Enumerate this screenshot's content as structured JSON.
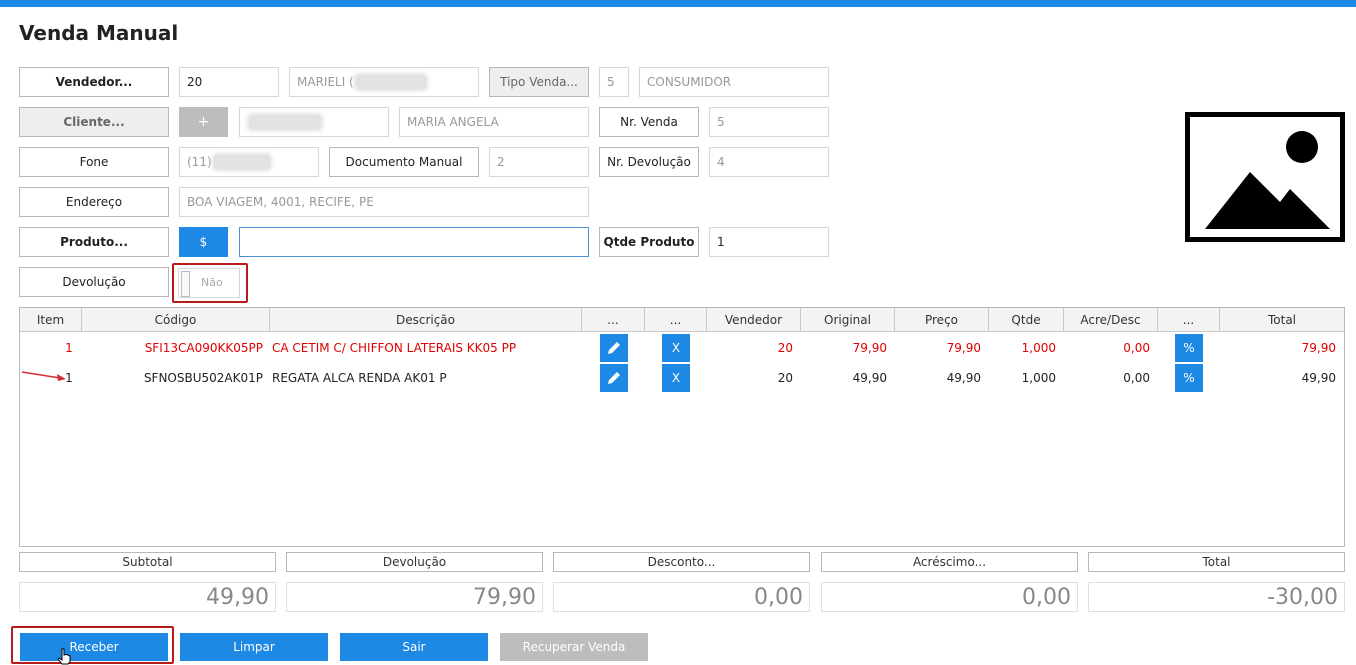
{
  "title": "Venda Manual",
  "form": {
    "vendedor_label": "Vendedor...",
    "vendedor_code": "20",
    "vendedor_name": "MARIELI (",
    "tipo_venda_label": "Tipo Venda...",
    "tipo_venda_code": "5",
    "tipo_venda_name": "CONSUMIDOR",
    "cliente_label": "Cliente...",
    "add_client_label": "+",
    "cliente_name": "MARIA ANGELA",
    "nr_venda_label": "Nr. Venda",
    "nr_venda_value": "5",
    "fone_label": "Fone",
    "fone_value": "(11)",
    "documento_label": "Documento Manual",
    "documento_value": "2",
    "nr_devolucao_label": "Nr. Devolução",
    "nr_devolucao_value": "4",
    "endereco_label": "Endereço",
    "endereco_value": "BOA VIAGEM, 4001, RECIFE, PE",
    "produto_label": "Produto...",
    "price_button_label": "$",
    "produto_value": "",
    "qtde_label": "Qtde Produto",
    "qtde_value": "1",
    "devolucao_label": "Devolução",
    "devolucao_toggle_text": "Não"
  },
  "grid": {
    "headers": [
      "Item",
      "Código",
      "Descrição",
      "...",
      "...",
      "Vendedor",
      "Original",
      "Preço",
      "Qtde",
      "Acre/Desc",
      "...",
      "Total"
    ],
    "rows": [
      {
        "item": "1",
        "codigo": "SFI13CA090KK05PP",
        "descricao": "CA CETIM C/ CHIFFON LATERAIS KK05 PP",
        "delete": "X",
        "vendedor": "20",
        "original": "79,90",
        "preco": "79,90",
        "qtde": "1,000",
        "acre_desc": "0,00",
        "percent": "%",
        "total": "79,90",
        "color": "#e00000"
      },
      {
        "item": "1",
        "codigo": "SFNOSBU502AK01P",
        "descricao": "REGATA ALCA RENDA AK01 P",
        "delete": "X",
        "vendedor": "20",
        "original": "49,90",
        "preco": "49,90",
        "qtde": "1,000",
        "acre_desc": "0,00",
        "percent": "%",
        "total": "49,90",
        "color": "#222222"
      }
    ]
  },
  "totals": {
    "subtotal_label": "Subtotal",
    "subtotal_value": "49,90",
    "devolucao_label": "Devolução",
    "devolucao_value": "79,90",
    "desconto_label": "Desconto...",
    "desconto_value": "0,00",
    "acrescimo_label": "Acréscimo...",
    "acrescimo_value": "0,00",
    "total_label": "Total",
    "total_value": "-30,00"
  },
  "actions": {
    "receber": "Receber",
    "limpar": "Limpar",
    "sair": "Sair",
    "recuperar": "Recuperar Venda"
  },
  "colors": {
    "accent": "#1e88e5",
    "highlight_box": "#b71c1c",
    "returned_row": "#e00000"
  }
}
